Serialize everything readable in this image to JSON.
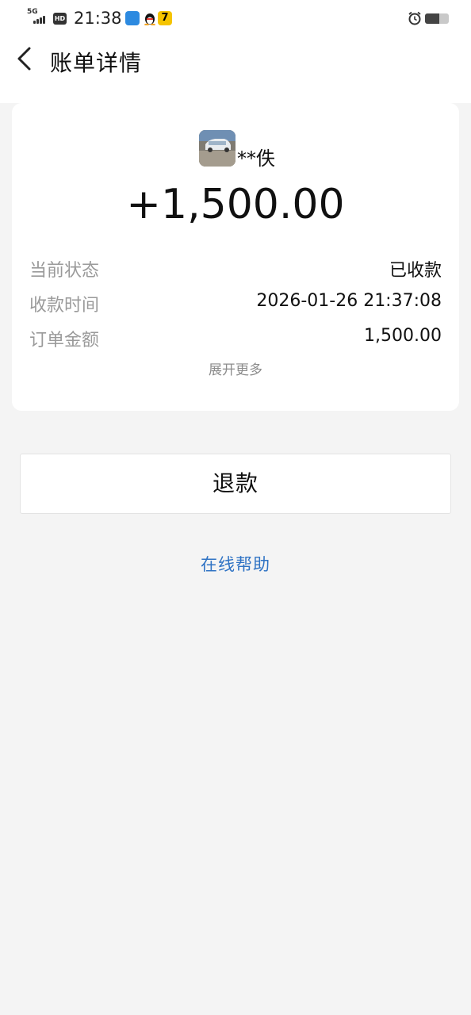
{
  "status_bar": {
    "network": "5G",
    "hd": "HD",
    "time": "21:38",
    "battery_level": 0.6,
    "app_icons": [
      "blue-app-icon",
      "qq-penguin-icon",
      "yellow-7-app-icon"
    ],
    "yellow_app_glyph": "7"
  },
  "header": {
    "title": "账单详情",
    "back_icon": "chevron-left-icon"
  },
  "bill": {
    "payer_name": "**佚",
    "amount": "+1,500.00",
    "details": [
      {
        "label": "当前状态",
        "value": "已收款"
      },
      {
        "label": "收款时间",
        "value": "2026-01-26 21:37:08"
      },
      {
        "label": "订单金额",
        "value": "1,500.00"
      }
    ],
    "expand_label": "展开更多"
  },
  "actions": {
    "refund_label": "退款",
    "help_label": "在线帮助"
  },
  "colors": {
    "background": "#f4f4f4",
    "card": "#ffffff",
    "link": "#2f73c4",
    "label_gray": "#9a9a9a"
  }
}
